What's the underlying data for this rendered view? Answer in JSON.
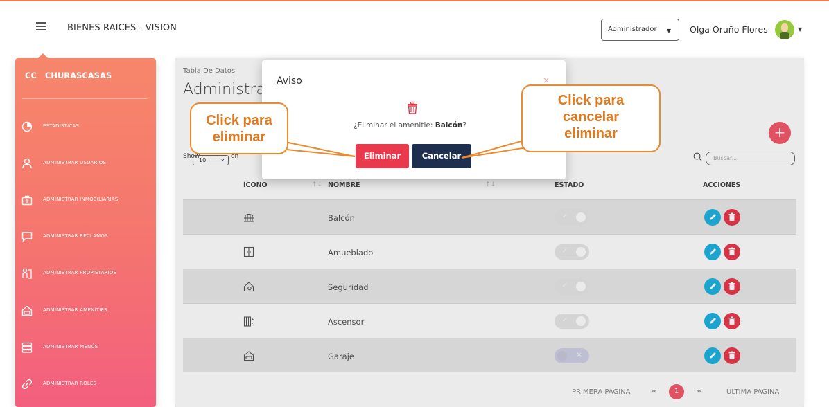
{
  "header": {
    "app_title": "BIENES RAICES - VISION",
    "role_selected": "Administrador",
    "user_name": "Olga Oruño Flores"
  },
  "sidebar": {
    "brand_short": "CC",
    "brand_name": "CHURASCASAS",
    "items": [
      {
        "label": "ESTADÍSTICAS",
        "icon": "chart-pie-icon"
      },
      {
        "label": "ADMINISTRAR USUARIOS",
        "icon": "user-icon"
      },
      {
        "label": "ADMINISTRAR INMOBILIARIAS",
        "icon": "briefcase-icon"
      },
      {
        "label": "ADMINISTRAR RECLAMOS",
        "icon": "chat-icon"
      },
      {
        "label": "ADMINISTRAR PROPIETARIOS",
        "icon": "owner-icon"
      },
      {
        "label": "ADMINISTRAR AMENITIES",
        "icon": "car-garage-icon",
        "active": true
      },
      {
        "label": "ADMINISTRAR MENÚS",
        "icon": "server-stack-icon"
      },
      {
        "label": "ADMINISTRAR ROLES",
        "icon": "link-icon"
      }
    ]
  },
  "page": {
    "breadcrumb": "Tabla De Datos",
    "title": "Administrar Amenities"
  },
  "table_controls": {
    "show_label": "Show",
    "show_value": "10",
    "show_tail": "en",
    "search_placeholder": "Buscar..."
  },
  "table": {
    "headers": {
      "icon": "ÍCONO",
      "name": "NOMBRE",
      "status": "ESTADO",
      "actions": "ACCIONES"
    },
    "rows": [
      {
        "icon": "balcony-icon",
        "name": "Balcón",
        "status": "on"
      },
      {
        "icon": "furniture-icon",
        "name": "Amueblado",
        "status": "on"
      },
      {
        "icon": "security-house-icon",
        "name": "Seguridad",
        "status": "on"
      },
      {
        "icon": "elevator-icon",
        "name": "Ascensor",
        "status": "on"
      },
      {
        "icon": "garage-icon",
        "name": "Garaje",
        "status": "off"
      }
    ]
  },
  "pagination": {
    "first": "PRIMERA PÁGINA",
    "current": "1",
    "last": "ÚLTIMA PÁGINA"
  },
  "modal": {
    "title": "Aviso",
    "close": "×",
    "message_prefix": "¿Eliminar el amenitie: ",
    "message_item": "Balcón",
    "message_suffix": "?",
    "confirm_label": "Eliminar",
    "cancel_label": "Cancelar"
  },
  "callouts": {
    "left": [
      "Click para",
      "eliminar"
    ],
    "right": [
      "Click para",
      "cancelar",
      "eliminar"
    ],
    "color": "#ec8a2e"
  },
  "colors": {
    "accent": "#f35a6a",
    "sidebar_top": "#f6876b",
    "sidebar_bottom": "#f35f7f",
    "edit": "#1eb2e0",
    "delete": "#e8394d",
    "cancel": "#1d2e4e"
  }
}
